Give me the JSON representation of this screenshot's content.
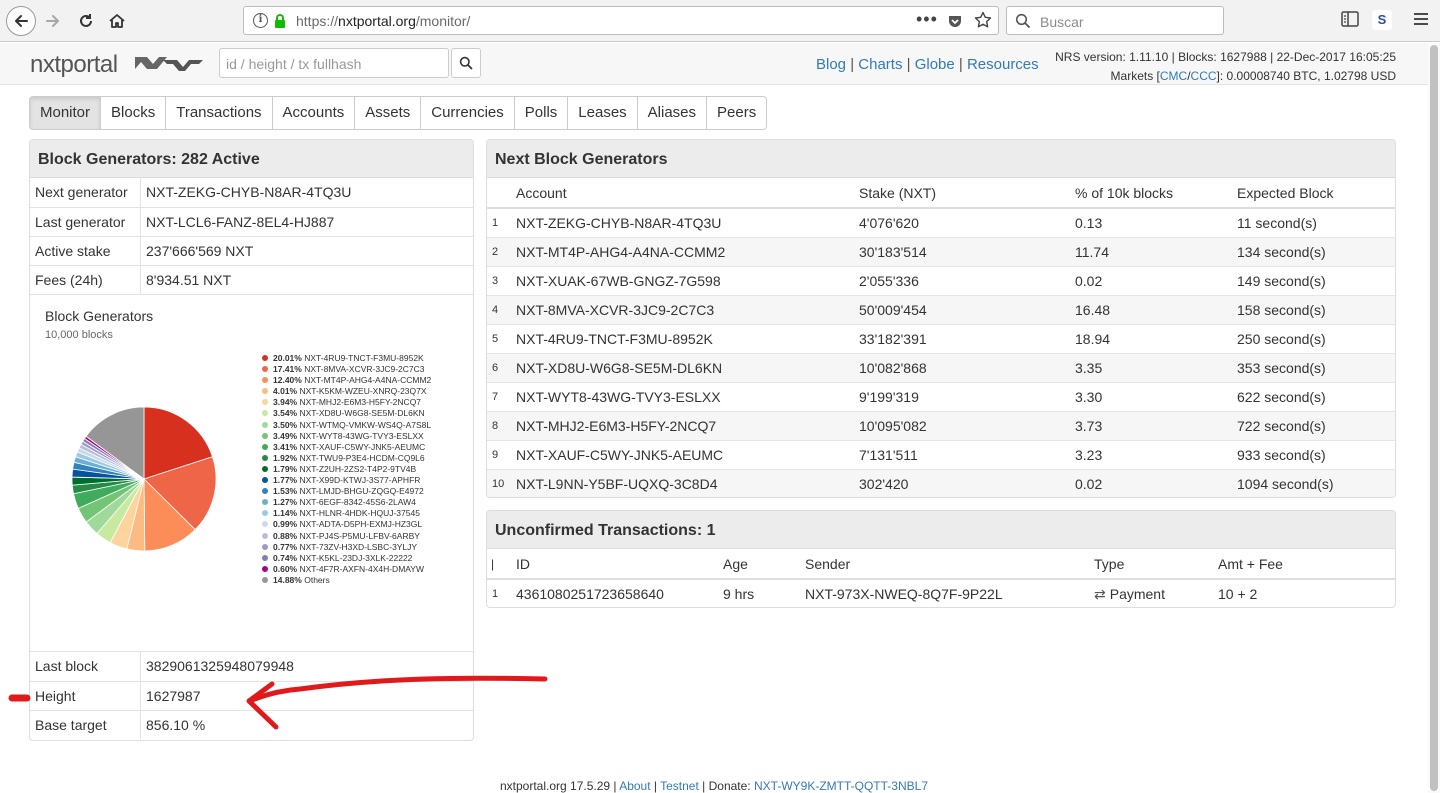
{
  "browser": {
    "url_prefix": "https://",
    "url_domain": "nxtportal.org",
    "url_path": "/monitor/",
    "search_placeholder": "Buscar",
    "ext_letter": "S"
  },
  "header": {
    "logo": "nxtportal",
    "search_placeholder": "id / height / tx fullhash",
    "links": [
      "Blog",
      "Charts",
      "Globe",
      "Resources"
    ],
    "nrs_line": "NRS version: 1.11.10 | Blocks: 1627988 | 22-Dec-2017 16:05:25",
    "markets_prefix": "Markets [",
    "markets_cmc": "CMC",
    "markets_ccc": "CCC",
    "markets_suffix": "]: 0.00008740 BTC, 1.02798 USD"
  },
  "tabs": [
    "Monitor",
    "Blocks",
    "Transactions",
    "Accounts",
    "Assets",
    "Currencies",
    "Polls",
    "Leases",
    "Aliases",
    "Peers"
  ],
  "generators_panel": {
    "title": "Block Generators: 282 Active",
    "rows": [
      {
        "k": "Next generator",
        "v": "NXT-ZEKG-CHYB-N8AR-4TQ3U"
      },
      {
        "k": "Last generator",
        "v": "NXT-LCL6-FANZ-8EL4-HJ887"
      },
      {
        "k": "Active stake",
        "v": "237'666'569 NXT"
      },
      {
        "k": "Fees (24h)",
        "v": "8'934.51 NXT"
      }
    ],
    "bottom_rows": [
      {
        "k": "Last block",
        "v": "3829061325948079948"
      },
      {
        "k": "Height",
        "v": "1627987"
      },
      {
        "k": "Base target",
        "v": "856.10 %"
      }
    ]
  },
  "chart_data": {
    "type": "pie",
    "title": "Block Generators",
    "subtitle": "10,000 blocks",
    "legend_position": "right",
    "slices": [
      {
        "pct": "20.01%",
        "value": 20.01,
        "label": "NXT-4RU9-TNCT-F3MU-8952K",
        "color": "#d7301f"
      },
      {
        "pct": "17.41%",
        "value": 17.41,
        "label": "NXT-8MVA-XCVR-3JC9-2C7C3",
        "color": "#ef6548"
      },
      {
        "pct": "12.40%",
        "value": 12.4,
        "label": "NXT-MT4P-AHG4-A4NA-CCMM2",
        "color": "#fc8d59"
      },
      {
        "pct": "4.01%",
        "value": 4.01,
        "label": "NXT-K5KM-WZEU-XNRQ-23Q7X",
        "color": "#fdbb84"
      },
      {
        "pct": "3.94%",
        "value": 3.94,
        "label": "NXT-MHJ2-E6M3-H5FY-2NCQ7",
        "color": "#fdd49e"
      },
      {
        "pct": "3.54%",
        "value": 3.54,
        "label": "NXT-XD8U-W6G8-SE5M-DL6KN",
        "color": "#c7e9a0"
      },
      {
        "pct": "3.50%",
        "value": 3.5,
        "label": "NXT-WTMQ-VMKW-WS4Q-A7S8L",
        "color": "#a1d99b"
      },
      {
        "pct": "3.49%",
        "value": 3.49,
        "label": "NXT-WYT8-43WG-TVY3-ESLXX",
        "color": "#74c476"
      },
      {
        "pct": "3.41%",
        "value": 3.41,
        "label": "NXT-XAUF-C5WY-JNK5-AEUMC",
        "color": "#41ab5d"
      },
      {
        "pct": "1.92%",
        "value": 1.92,
        "label": "NXT-TWU9-P3E4-HCDM-CQ9L6",
        "color": "#238b45"
      },
      {
        "pct": "1.79%",
        "value": 1.79,
        "label": "NXT-Z2UH-2ZS2-T4P2-9TV4B",
        "color": "#006d2c"
      },
      {
        "pct": "1.77%",
        "value": 1.77,
        "label": "NXT-X99D-KTWJ-3S77-APHFR",
        "color": "#08519c"
      },
      {
        "pct": "1.53%",
        "value": 1.53,
        "label": "NXT-LMJD-BHGU-ZQGQ-E4972",
        "color": "#3182bd"
      },
      {
        "pct": "1.27%",
        "value": 1.27,
        "label": "NXT-6EGF-8342-45S6-2LAW4",
        "color": "#6baed6"
      },
      {
        "pct": "1.14%",
        "value": 1.14,
        "label": "NXT-HLNR-4HDK-HQUJ-37545",
        "color": "#9ecae1"
      },
      {
        "pct": "0.99%",
        "value": 0.99,
        "label": "NXT-ADTA-D5PH-EXMJ-HZ3GL",
        "color": "#c6dbef"
      },
      {
        "pct": "0.88%",
        "value": 0.88,
        "label": "NXT-PJ4S-P5MU-LFBV-6ARBY",
        "color": "#bcbddc"
      },
      {
        "pct": "0.77%",
        "value": 0.77,
        "label": "NXT-73ZV-H3XD-LSBC-3YLJY",
        "color": "#9e9ac8"
      },
      {
        "pct": "0.74%",
        "value": 0.74,
        "label": "NXT-K5KL-23DJ-3XLK-22222",
        "color": "#807dba"
      },
      {
        "pct": "0.60%",
        "value": 0.6,
        "label": "NXT-4F7R-AXFN-4X4H-DMAYW",
        "color": "#ae017e"
      },
      {
        "pct": "14.88%",
        "value": 14.88,
        "label": "Others",
        "color": "#969696"
      }
    ]
  },
  "next_generators": {
    "title": "Next Block Generators",
    "headers": [
      "Account",
      "Stake (NXT)",
      "% of 10k blocks",
      "Expected Block"
    ],
    "rows": [
      [
        "1",
        "NXT-ZEKG-CHYB-N8AR-4TQ3U",
        "4'076'620",
        "0.13",
        "11 second(s)"
      ],
      [
        "2",
        "NXT-MT4P-AHG4-A4NA-CCMM2",
        "30'183'514",
        "11.74",
        "134 second(s)"
      ],
      [
        "3",
        "NXT-XUAK-67WB-GNGZ-7G598",
        "2'055'336",
        "0.02",
        "149 second(s)"
      ],
      [
        "4",
        "NXT-8MVA-XCVR-3JC9-2C7C3",
        "50'009'454",
        "16.48",
        "158 second(s)"
      ],
      [
        "5",
        "NXT-4RU9-TNCT-F3MU-8952K",
        "33'182'391",
        "18.94",
        "250 second(s)"
      ],
      [
        "6",
        "NXT-XD8U-W6G8-SE5M-DL6KN",
        "10'082'868",
        "3.35",
        "353 second(s)"
      ],
      [
        "7",
        "NXT-WYT8-43WG-TVY3-ESLXX",
        "9'199'319",
        "3.30",
        "622 second(s)"
      ],
      [
        "8",
        "NXT-MHJ2-E6M3-H5FY-2NCQ7",
        "10'095'082",
        "3.73",
        "722 second(s)"
      ],
      [
        "9",
        "NXT-XAUF-C5WY-JNK5-AEUMC",
        "7'131'511",
        "3.23",
        "933 second(s)"
      ],
      [
        "10",
        "NXT-L9NN-Y5BF-UQXQ-3C8D4",
        "302'420",
        "0.02",
        "1094 second(s)"
      ]
    ]
  },
  "unconfirmed": {
    "title": "Unconfirmed Transactions: 1",
    "headers": [
      "|",
      "ID",
      "Age",
      "Sender",
      "Type",
      "Amt + Fee"
    ],
    "rows": [
      [
        "1",
        "4361080251723658640",
        "9 hrs",
        "NXT-973X-NWEQ-8Q7F-9P22L",
        "Payment",
        "10 + 2"
      ]
    ]
  },
  "footer": {
    "prefix": "nxtportal.org 17.5.29 | ",
    "about": "About",
    "testnet": "Testnet",
    "donate_label": " | Donate: ",
    "donate_addr": "NXT-WY9K-ZMTT-QQTT-3NBL7"
  },
  "colors": {
    "link": "#337ab7",
    "annotation": "#e01a1a"
  }
}
